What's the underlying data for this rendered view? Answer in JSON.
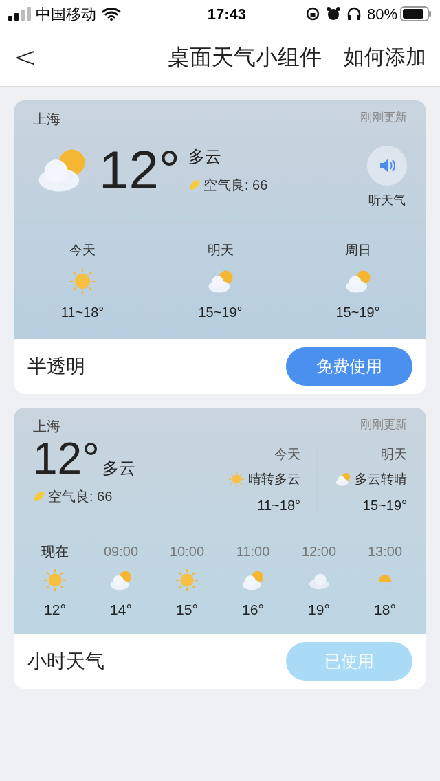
{
  "status_bar": {
    "carrier": "中国移动",
    "time": "17:43",
    "battery": "80%"
  },
  "nav": {
    "back": "<",
    "title": "桌面天气小组件",
    "action": "如何添加"
  },
  "widgets": [
    {
      "kind": "daily",
      "city": "上海",
      "updated": "刚刚更新",
      "temp": "12°",
      "condition": "多云",
      "aqi": "空气良: 66",
      "listen": "听天气",
      "days": [
        {
          "label": "今天",
          "kind": "sunny",
          "range": "11~18°"
        },
        {
          "label": "明天",
          "kind": "partly_cloudy",
          "range": "15~19°"
        },
        {
          "label": "周日",
          "kind": "partly_cloudy",
          "range": "15~19°"
        }
      ],
      "name": "半透明",
      "button": {
        "label": "免费使用",
        "disabled": false
      }
    },
    {
      "kind": "hourly",
      "city": "上海",
      "updated": "刚刚更新",
      "temp": "12°",
      "condition": "多云",
      "aqi": "空气良: 66",
      "days": [
        {
          "label": "今天",
          "kind": "sunny",
          "desc": "晴转多云",
          "range": "11~18°"
        },
        {
          "label": "明天",
          "kind": "partly_cloudy",
          "desc": "多云转晴",
          "range": "15~19°"
        }
      ],
      "hours": [
        {
          "time": "现在",
          "now": true,
          "kind": "sunny",
          "temp": "12°"
        },
        {
          "time": "09:00",
          "now": false,
          "kind": "partly_cloudy",
          "temp": "14°"
        },
        {
          "time": "10:00",
          "now": false,
          "kind": "sunny",
          "temp": "15°"
        },
        {
          "time": "11:00",
          "now": false,
          "kind": "partly_cloudy",
          "temp": "16°"
        },
        {
          "time": "12:00",
          "now": false,
          "kind": "cloudy",
          "temp": "19°"
        },
        {
          "time": "13:00",
          "now": false,
          "kind": "haze",
          "temp": "18°"
        }
      ],
      "name": "小时天气",
      "button": {
        "label": "已使用",
        "disabled": true
      }
    }
  ]
}
